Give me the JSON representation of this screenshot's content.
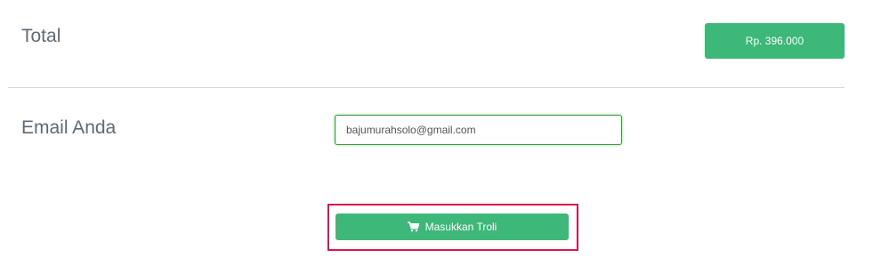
{
  "summary": {
    "total_label": "Total",
    "total_value": "Rp. 396.000"
  },
  "email": {
    "label": "Email Anda",
    "value": "bajumurahsolo@gmail.com"
  },
  "cart": {
    "button_label": "Masukkan Troli",
    "icon": "shopping-cart-icon"
  },
  "colors": {
    "accent_green": "#3db878",
    "highlight_red": "#d9174a",
    "text": "#5f6b74"
  }
}
